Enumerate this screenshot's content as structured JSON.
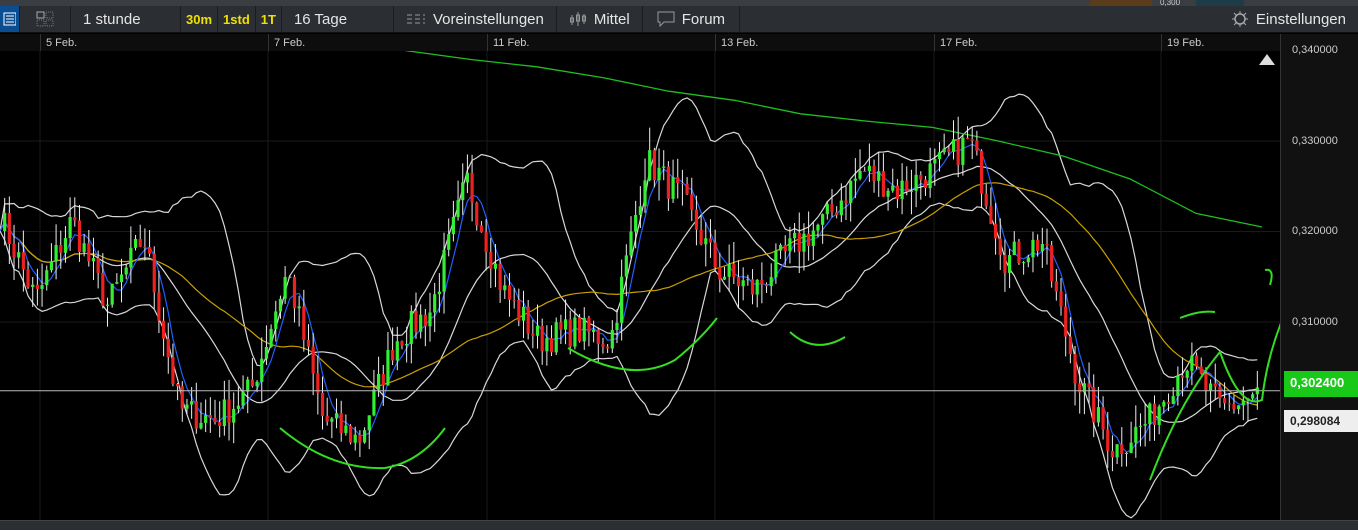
{
  "toolbar": {
    "interval": "1 stunde",
    "quick": [
      "30m",
      "1std",
      "1T"
    ],
    "range": "16 Tage",
    "presets": "Voreinstellungen",
    "indicators": "Mittel",
    "forum": "Forum",
    "settings": "Einstellungen"
  },
  "top_strip_value": "0,300",
  "chart_data": {
    "type": "candlestick",
    "x_ticks": [
      "5 Feb.",
      "7 Feb.",
      "11 Feb.",
      "13 Feb.",
      "17 Feb.",
      "19 Feb."
    ],
    "y_ticks": [
      "0,340000",
      "0,330000",
      "0,320000",
      "0,310000"
    ],
    "ylim": [
      0.294,
      0.34
    ],
    "current_price": "0,302400",
    "reference_price": "0,298084",
    "closes": [
      0.3218,
      0.3124,
      0.3213,
      0.3118,
      0.3195,
      0.3003,
      0.2992,
      0.3025,
      0.3157,
      0.2992,
      0.297,
      0.308,
      0.3113,
      0.3257,
      0.3135,
      0.308,
      0.3091,
      0.308,
      0.3279,
      0.3235,
      0.3157,
      0.3135,
      0.318,
      0.3213,
      0.3268,
      0.3246,
      0.3268,
      0.3301,
      0.3168,
      0.319,
      0.3036,
      0.2958,
      0.2992,
      0.3058,
      0.3003,
      0.302
    ]
  }
}
